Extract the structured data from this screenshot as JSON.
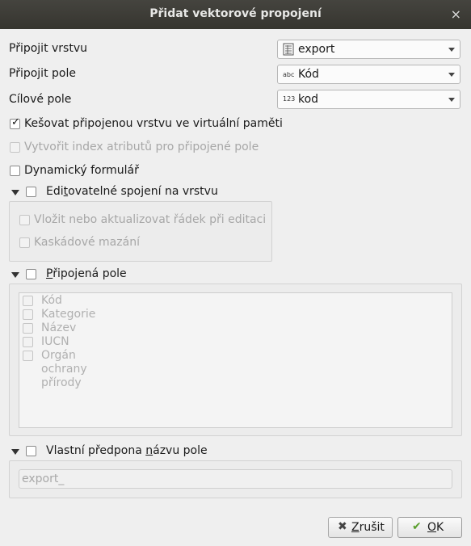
{
  "window": {
    "title": "Přidat vektorové propojení",
    "close_glyph": "×"
  },
  "join_layer": {
    "label": "Připojit vrstvu",
    "value": "export",
    "icon": "table-icon"
  },
  "join_field": {
    "label": "Připojit pole",
    "value": "Kód",
    "type_badge": "abc"
  },
  "target_field": {
    "label": "Cílové pole",
    "value": "kod",
    "type_badge": "123"
  },
  "cache_checkbox": {
    "label": "Kešovat připojenou vrstvu ve virtuální paměti",
    "checked": true
  },
  "index_checkbox": {
    "label": "Vytvořit index atributů pro připojené pole",
    "checked": false,
    "enabled": false
  },
  "dynamic_form_checkbox": {
    "label": "Dynamický formulář",
    "checked": false
  },
  "editable_group": {
    "label_pre": "Edi",
    "label_accel": "t",
    "label_post": "ovatelné spojení na vrstvu",
    "checked": false,
    "options": [
      {
        "label": "Vložit nebo aktualizovat řádek při editaci"
      },
      {
        "label": "Kaskádové mazání"
      }
    ]
  },
  "joined_fields_group": {
    "label_pre": "",
    "label_accel": "P",
    "label_post": "řipojená pole",
    "checked": false,
    "fields": [
      "Kód",
      "Kategorie",
      "Název",
      "IUCN",
      "Orgán ochrany přírody"
    ]
  },
  "prefix_group": {
    "label_pre": "Vlastní předpona ",
    "label_accel": "n",
    "label_post": "ázvu pole",
    "checked": false,
    "value": "export_"
  },
  "buttons": {
    "cancel": {
      "accel": "Z",
      "rest": "rušit",
      "icon": "cancel-x-icon"
    },
    "ok": {
      "accel": "O",
      "rest": "K",
      "icon": "ok-check-icon"
    }
  },
  "colors": {
    "titlebar": "#3c3b37",
    "background": "#efefef",
    "disabled_text": "#a7a7a7"
  }
}
